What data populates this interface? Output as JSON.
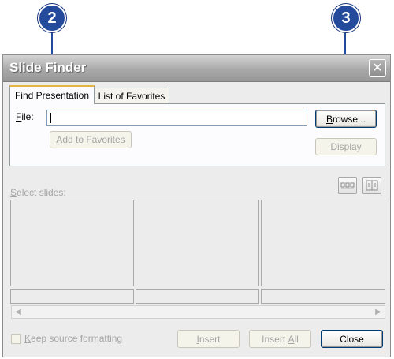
{
  "callouts": {
    "first": "2",
    "second": "3"
  },
  "window": {
    "title": "Slide Finder",
    "close_glyph": "✕"
  },
  "tabs": {
    "find_presentation": "Find Presentation",
    "list_of_favorites": "List of Favorites"
  },
  "file": {
    "label_access": "F",
    "label_rest": "ile:",
    "value": ""
  },
  "buttons": {
    "browse_access": "B",
    "browse_rest": "rowse...",
    "add_favorites_access": "A",
    "add_favorites_rest": "dd to Favorites",
    "display_access": "D",
    "display_rest": "isplay",
    "insert_access": "I",
    "insert_rest": "nsert",
    "insert_all_rest_1": "Insert ",
    "insert_all_access": "A",
    "insert_all_rest_2": "ll",
    "close": "Close"
  },
  "select_slides": {
    "access": "S",
    "rest": "elect slides:"
  },
  "keep_source": {
    "access": "K",
    "rest": "eep source formatting",
    "checked": false
  },
  "scroll": {
    "left_glyph": "◀",
    "right_glyph": "▶"
  },
  "colors": {
    "callout": "#244a9c",
    "titlebar": "#a9a9a9",
    "button_border": "#003c74"
  },
  "icons": [
    "slide-view-icon",
    "list-view-icon"
  ]
}
